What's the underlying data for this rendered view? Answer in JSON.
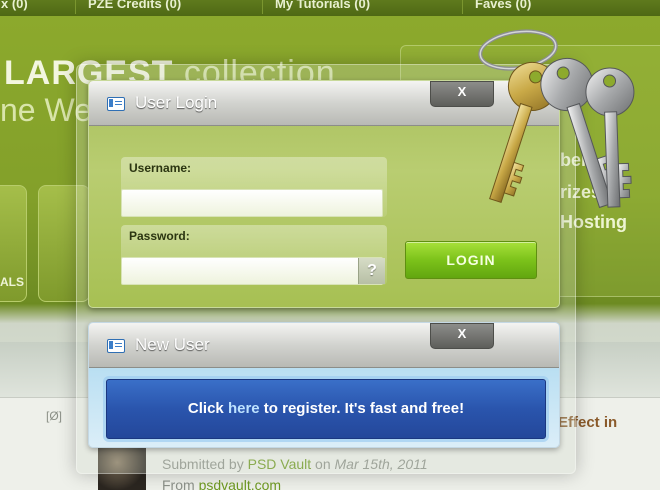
{
  "background": {
    "top_nav": [
      {
        "label": "x (0)"
      },
      {
        "label": "PZE Credits (0)"
      },
      {
        "label": "My Tutorials (0)"
      },
      {
        "label": "Faves (0)"
      }
    ],
    "hero_strong": "LARGEST",
    "hero_thin": "collection",
    "hero_line2": "ne We",
    "category_label": "ALS",
    "side_items": [
      "als",
      "bers",
      "rizes",
      "Hosting"
    ],
    "list_bracket": "[Ø]",
    "list_title_fragment": "Effect in",
    "submitted_prefix": "Submitted by",
    "submitted_author": "PSD Vault",
    "submitted_on": "on",
    "submitted_date": "Mar 15th, 2011",
    "from_prefix": "From",
    "from_link": "psdvault.com"
  },
  "login_window": {
    "title": "User Login",
    "close_label": "X",
    "username_label": "Username:",
    "username_value": "",
    "password_label": "Password:",
    "password_value": "",
    "help_label": "?",
    "login_button": "LOGIN"
  },
  "newuser_window": {
    "title": "New User",
    "close_label": "X",
    "register_prefix": "Click",
    "register_link": "here",
    "register_suffix": "to register. It's fast and free!"
  },
  "colors": {
    "page_green": "#8daa2d",
    "login_green": "#7cc21a",
    "register_blue": "#2a55ad",
    "link_green": "#6f9a22"
  },
  "icons": {
    "window_icon": "window-icon",
    "keys": "keys-icon",
    "help": "question-icon"
  }
}
